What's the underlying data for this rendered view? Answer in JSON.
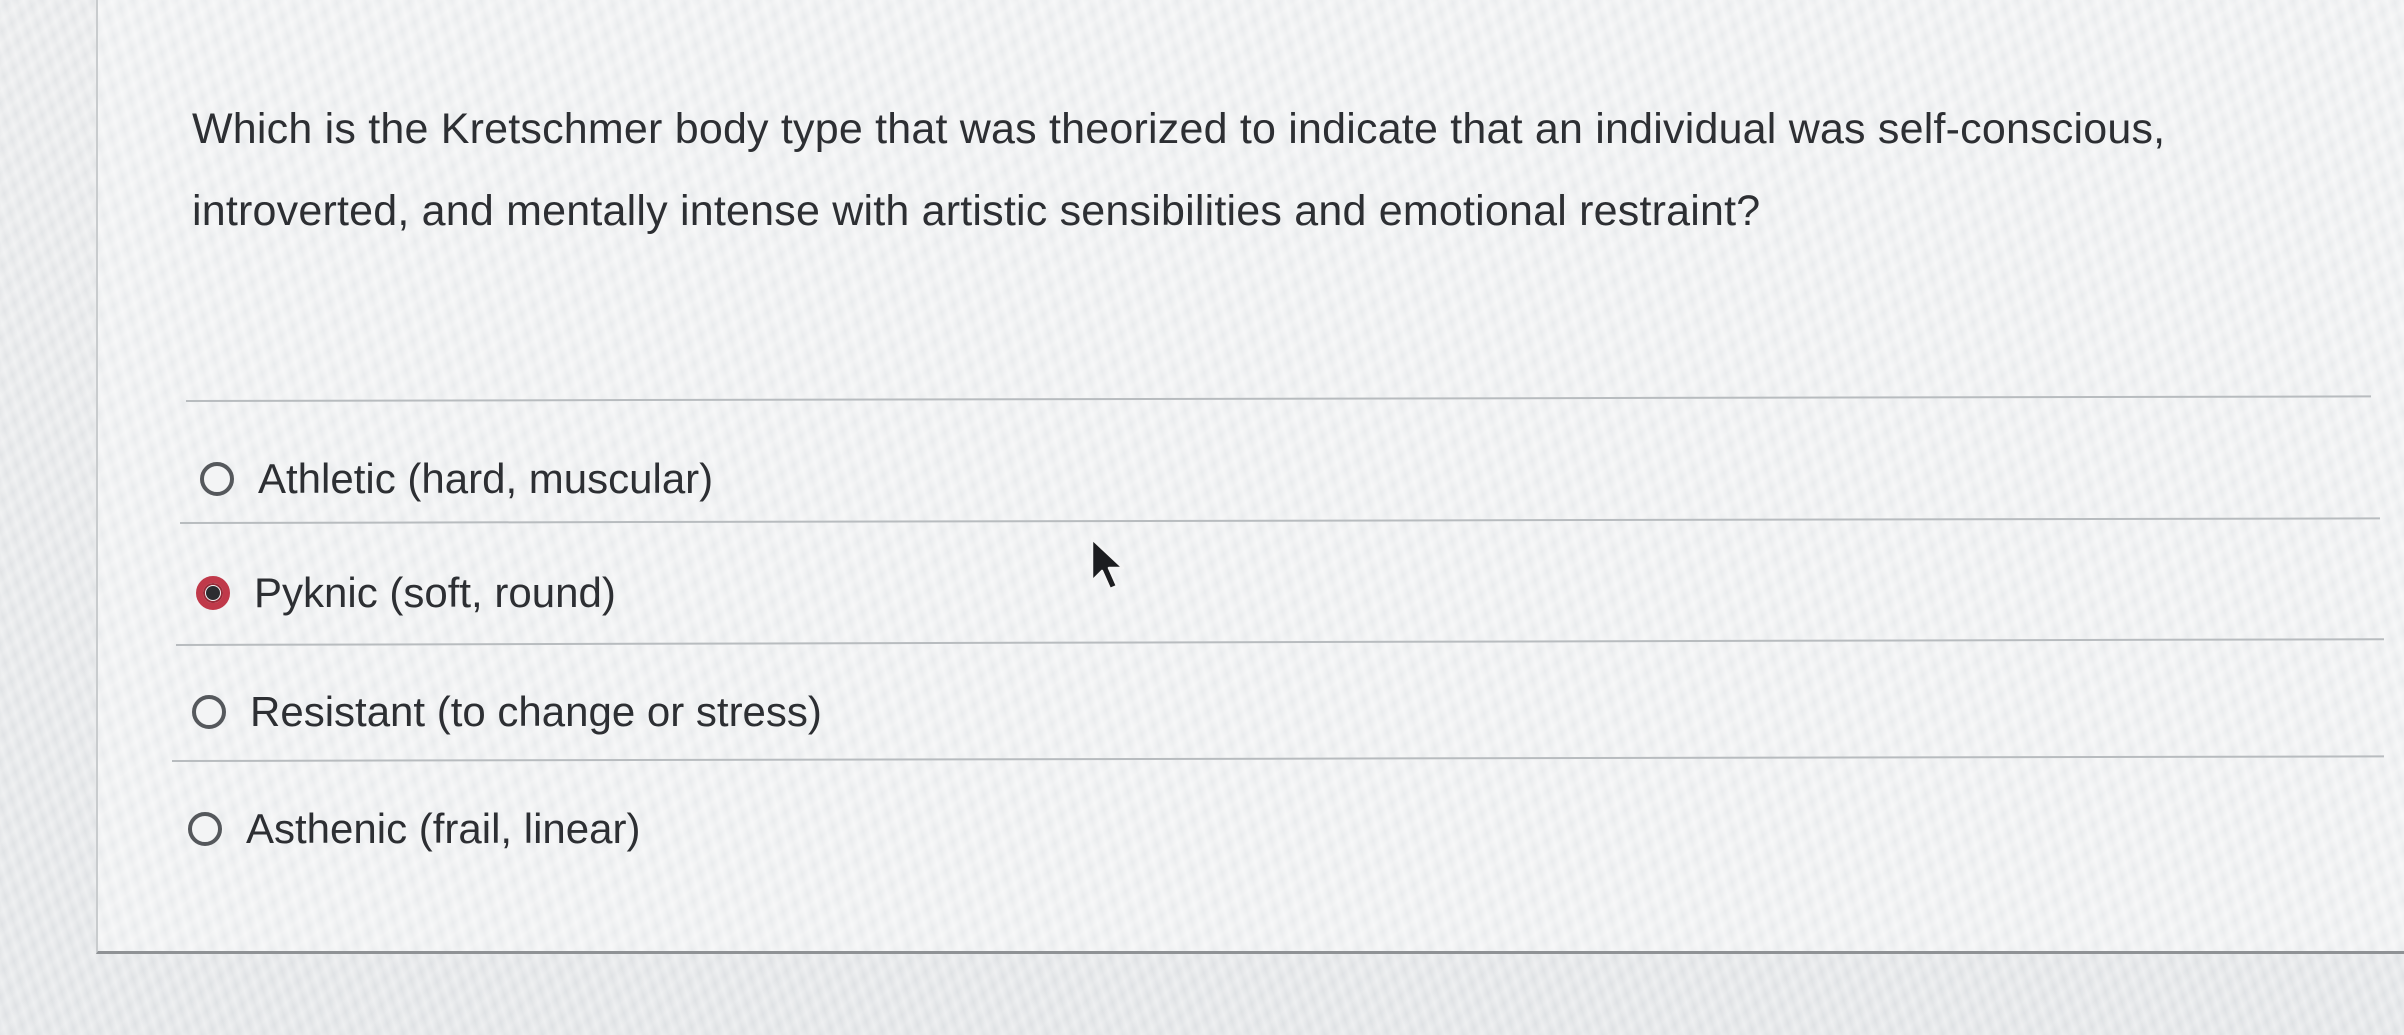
{
  "question": {
    "text": "Which is the Kretschmer body type that was theorized to indicate that an individual was self-conscious, introverted, and mentally intense with artistic sensibilities and emotional restraint?"
  },
  "options": [
    {
      "label": "Athletic (hard, muscular)",
      "selected": false
    },
    {
      "label": "Pyknic (soft, round)",
      "selected": true
    },
    {
      "label": "Resistant (to change or stress)",
      "selected": false
    },
    {
      "label": "Asthenic (frail, linear)",
      "selected": false
    }
  ],
  "colors": {
    "selected_ring": "#c0394a",
    "text": "#2d2f33",
    "divider": "#b8bcbf"
  },
  "icons": {
    "cursor": "mouse-pointer-icon"
  }
}
